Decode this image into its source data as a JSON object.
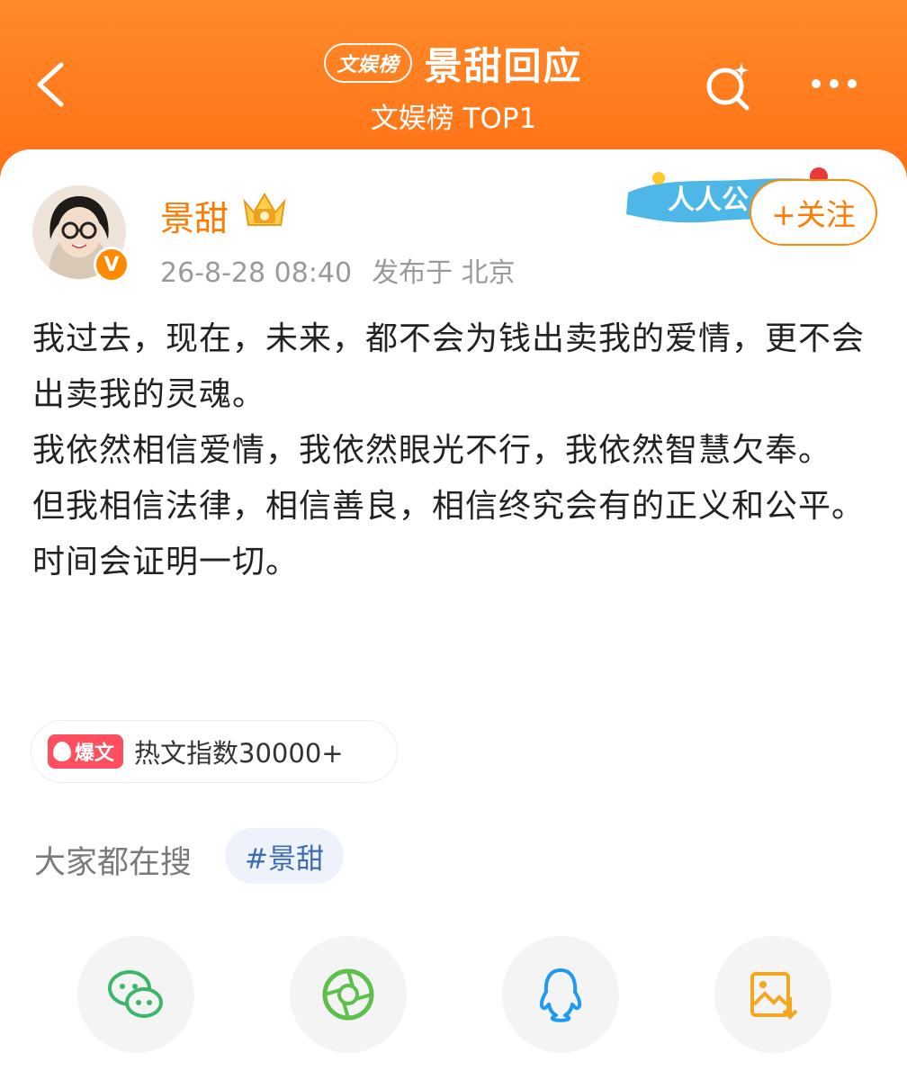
{
  "header": {
    "channel_badge": "文娱榜",
    "title": "景甜回应",
    "subtitle": "文娱榜 TOP1"
  },
  "post": {
    "username": "景甜",
    "timestamp": "26-8-28 08:40",
    "location": "发布于 北京",
    "follow_label": "+关注",
    "banner_text": "人人公",
    "verified_mark": "V",
    "body": [
      "我过去，现在，未来，都不会为钱出卖我的爱情，更不会出卖我的灵魂。",
      "我依然相信爱情，我依然眼光不行，我依然智慧欠奉。",
      "但我相信法律，相信善良，相信终究会有的正义和公平。",
      "时间会证明一切。"
    ],
    "hot_badge": "爆文",
    "hot_index": "热文指数30000+"
  },
  "related_search": {
    "label": "大家都在搜",
    "tag": "#景甜"
  },
  "share": {
    "icons": [
      "wechat-icon",
      "moments-icon",
      "qq-icon",
      "save-image-icon"
    ]
  },
  "colors": {
    "header_orange": "#ff7a1c",
    "accent_orange": "#ff7a00",
    "hot_red": "#ff4f5e",
    "tag_blue": "#3d6cb0"
  }
}
